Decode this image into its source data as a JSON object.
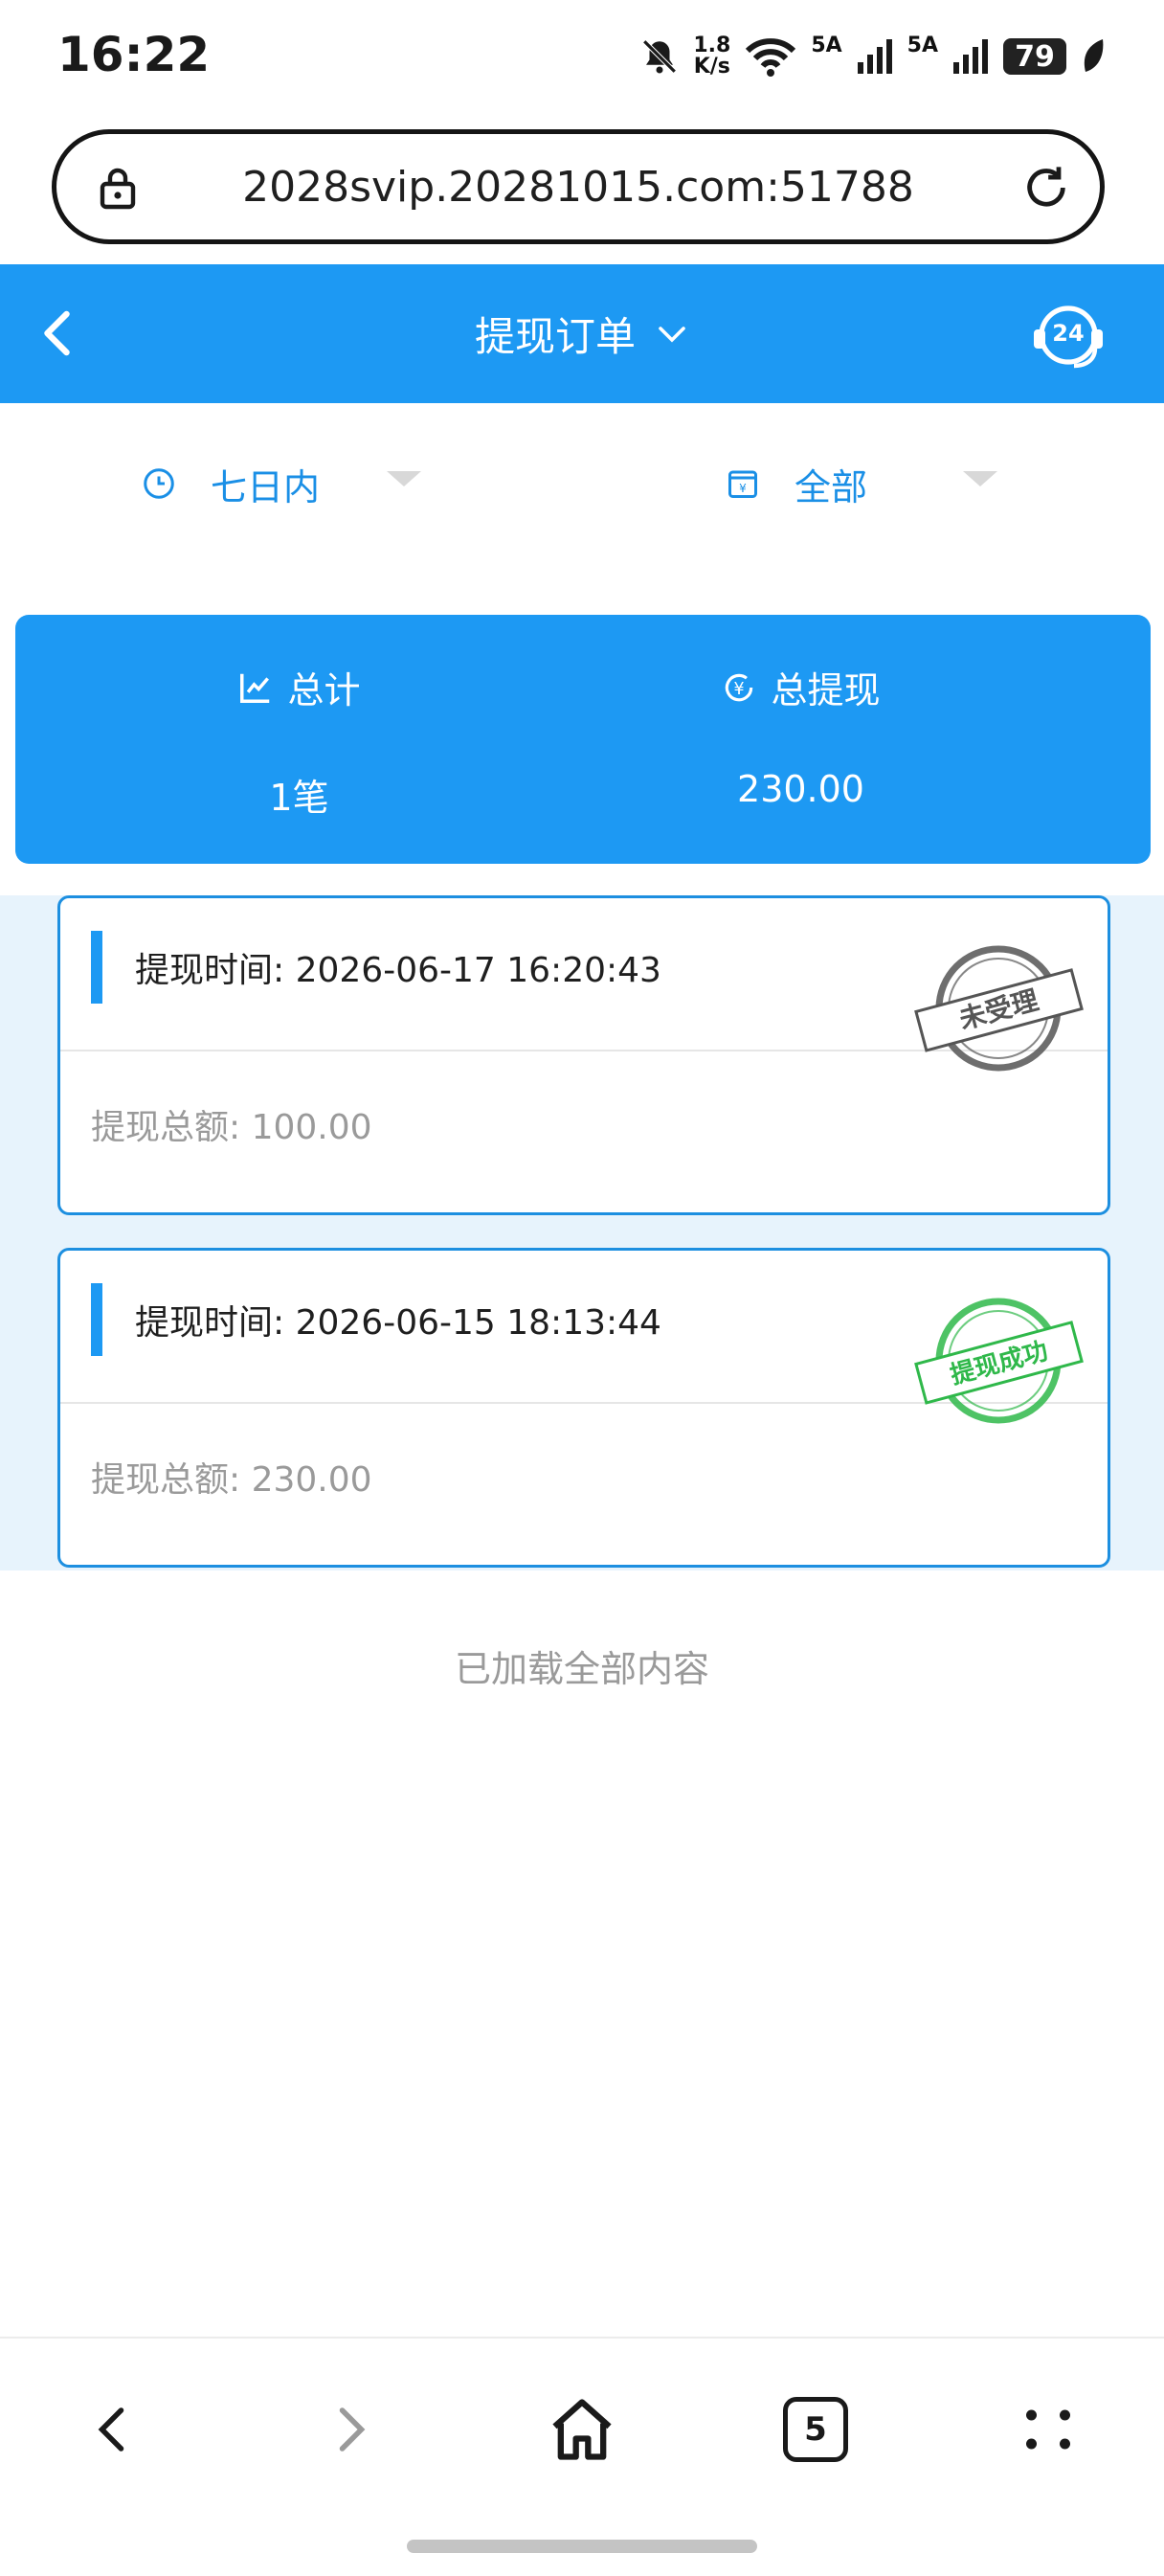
{
  "status_bar": {
    "time": "16:22",
    "speed_value": "1.8",
    "speed_unit": "K/s",
    "signal1": "5A",
    "signal2": "5A",
    "battery": "79"
  },
  "browser": {
    "url": "2028svip.20281015.com:51788",
    "tab_count": "5"
  },
  "header": {
    "title": "提现订单",
    "support_badge": "24"
  },
  "filters": {
    "time_range": "七日内",
    "status": "全部"
  },
  "summary": {
    "total_label": "总计",
    "total_value": "1笔",
    "withdraw_label": "总提现",
    "withdraw_value": "230.00"
  },
  "orders": [
    {
      "time_label": "提现时间:",
      "time": "2026-06-17 16:20:43",
      "amount_label": "提现总额:",
      "amount": "100.00",
      "stamp_text": "未受理",
      "stamp_color": "#555555"
    },
    {
      "time_label": "提现时间:",
      "time": "2026-06-15 18:13:44",
      "amount_label": "提现总额:",
      "amount": "230.00",
      "stamp_text": "提现成功",
      "stamp_color": "#2fb84a"
    }
  ],
  "footer_text": "已加载全部内容",
  "colors": {
    "primary": "#1d99f3",
    "list_bg": "#e7f3fc"
  }
}
